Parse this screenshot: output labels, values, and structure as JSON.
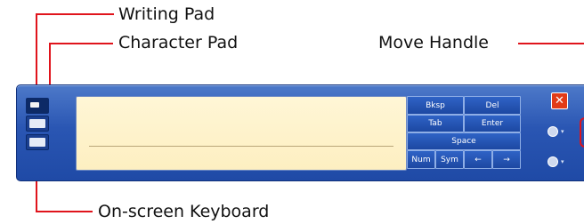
{
  "callouts": {
    "writing_pad": "Writing Pad",
    "character_pad": "Character Pad",
    "move_handle": "Move Handle",
    "onscreen_keyboard": "On-screen Keyboard"
  },
  "keys": {
    "bksp": "Bksp",
    "del": "Del",
    "tab": "Tab",
    "enter": "Enter",
    "space": "Space",
    "num": "Num",
    "sym": "Sym",
    "left": "←",
    "right": "→"
  },
  "close_label": "✕",
  "colors": {
    "callout_line": "#e0141c",
    "panel": "#2a56b3",
    "writing_area": "#fdefc1",
    "close_button": "#e23b17"
  },
  "icons": [
    "gear-icon",
    "help-icon",
    "close-icon"
  ]
}
